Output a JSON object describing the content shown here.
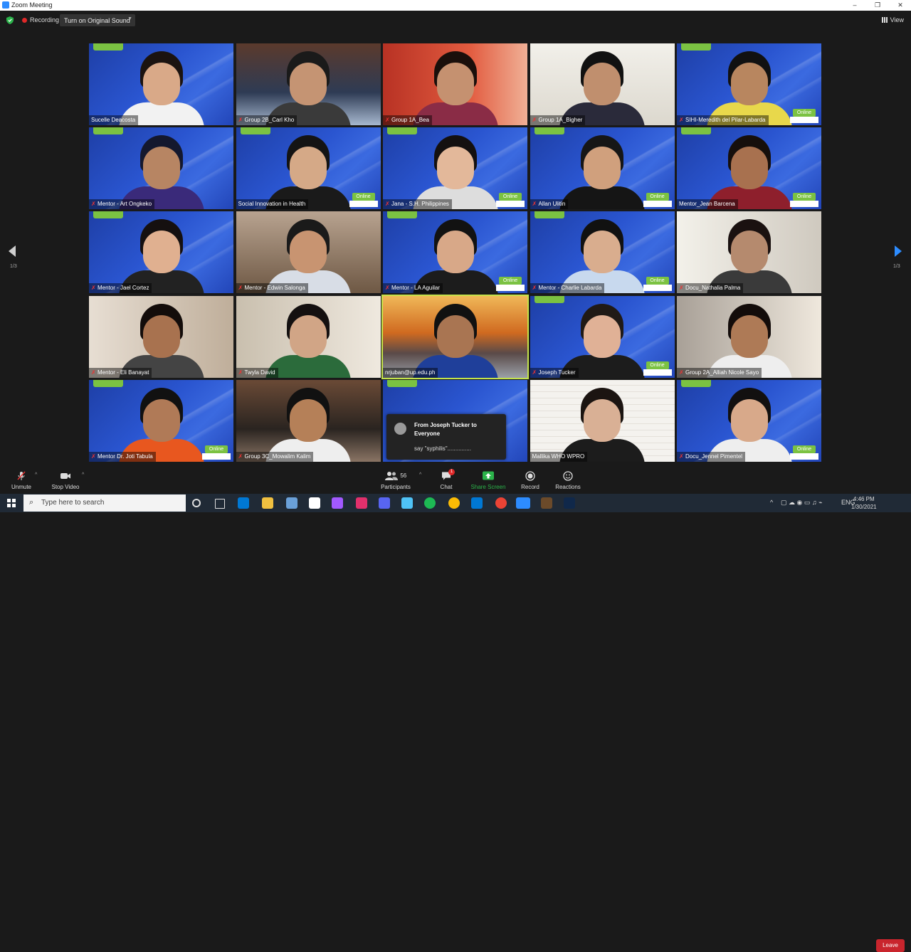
{
  "window": {
    "title": "Zoom Meeting",
    "minimize": "–",
    "maximize": "❐",
    "close": "✕"
  },
  "topbar": {
    "recording_label": "Recording",
    "original_sound_button": "Turn on Original Sound",
    "view_label": "View"
  },
  "pager": {
    "left": "1/3",
    "right": "1/3"
  },
  "participants": [
    {
      "name": "Sucelle Deacosta",
      "muted": false
    },
    {
      "name": "Group 2B_Carl Kho",
      "muted": true
    },
    {
      "name": "Group 1A_Bea",
      "muted": true
    },
    {
      "name": "Group 1A_Bigher",
      "muted": true
    },
    {
      "name": "SIHI-Meredith del Pilar-Labarda",
      "muted": true
    },
    {
      "name": "Mentor - Art Ongkeko",
      "muted": true
    },
    {
      "name": "Social Innovation in Health",
      "muted": false
    },
    {
      "name": "Jana - S.H. Philippines",
      "muted": true
    },
    {
      "name": "Allan Ulitin",
      "muted": true
    },
    {
      "name": "Mentor_Jean Barcena",
      "muted": false
    },
    {
      "name": "Mentor - Jael Cortez",
      "muted": true
    },
    {
      "name": "Mentor - Edwin Salonga",
      "muted": true
    },
    {
      "name": "Mentor - LA Aguilar",
      "muted": true
    },
    {
      "name": "Mentor - Charlie Labarda",
      "muted": true
    },
    {
      "name": "Docu_Nathalia Palma",
      "muted": true
    },
    {
      "name": "Mentor - Eli Banayat",
      "muted": true
    },
    {
      "name": "Twyla David",
      "muted": true
    },
    {
      "name": "nrjuban@up.edu.ph",
      "muted": false
    },
    {
      "name": "Joseph Tucker",
      "muted": true
    },
    {
      "name": "Group 2A_Alliah Nicole Sayo",
      "muted": true
    },
    {
      "name": "Mentor Dr. Joti Tabula",
      "muted": true
    },
    {
      "name": "Group 3C_Mowalim Kalim",
      "muted": true
    },
    {
      "name": "",
      "muted": false
    },
    {
      "name": "Mallika WHO WPRO",
      "muted": false
    },
    {
      "name": "Docu_Jennel Pimentel",
      "muted": true
    }
  ],
  "online_badge": "Online",
  "chat_popup": {
    "from": "From Joseph Tucker to Everyone",
    "message": "say \"syphilis\"..............."
  },
  "toolbar": {
    "unmute": "Unmute",
    "stop_video": "Stop Video",
    "participants": "Participants",
    "participants_count": "56",
    "chat": "Chat",
    "chat_badge": "1",
    "share_screen": "Share Screen",
    "record": "Record",
    "reactions": "Reactions",
    "leave": "Leave"
  },
  "taskbar": {
    "search_placeholder": "Type here to search",
    "language": "ENG",
    "time": "4:46 PM",
    "date": "1/30/2021"
  },
  "colors": {
    "accent_green": "#7bc242",
    "zoom_blue": "#2d8cff",
    "leave_red": "#c9252d",
    "active_speaker": "#c4e24a"
  }
}
